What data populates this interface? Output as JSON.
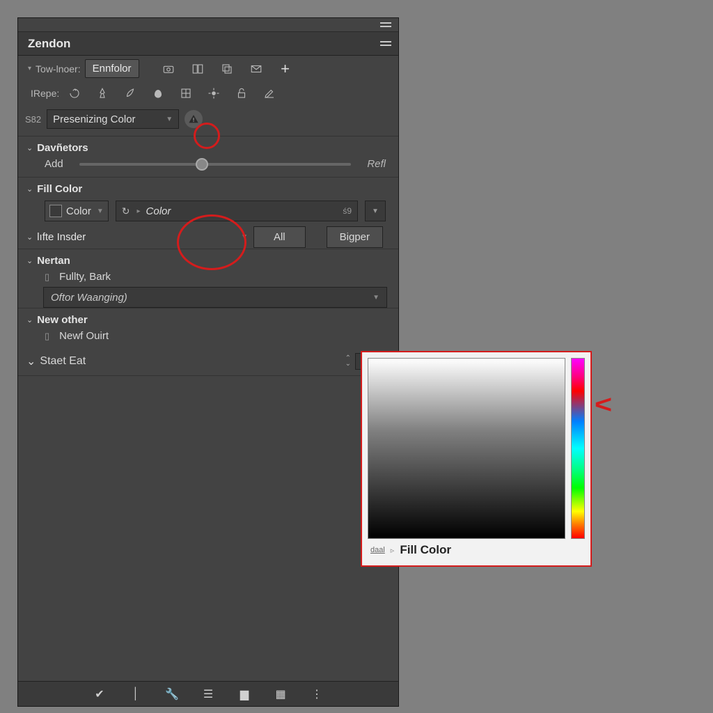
{
  "panel": {
    "title": "Zendon",
    "row1": {
      "label": "Tow-lnoer:",
      "button": "Ennfolor"
    },
    "row2": {
      "label": "IRepe:"
    },
    "preset": {
      "tag": "S82",
      "value": "Presenizing Color"
    },
    "sections": {
      "davnetors": {
        "label": "Davñetors",
        "slider_left": "Add",
        "slider_right": "Refl"
      },
      "fillcolor": {
        "label": "Fill Color",
        "swatch_label": "Color",
        "dd_label": "Color",
        "dd_tail": "ś9",
        "btn_all": "All",
        "btn_bigper": "Bigper"
      },
      "insider": {
        "label": "lıfte Insder"
      },
      "nertan": {
        "label": "Nertan",
        "sub": "Fullty, Bark",
        "dd": "Oftor Waanging)"
      },
      "newother": {
        "label": "New other",
        "sub": "Newf Ouirt"
      },
      "staet": {
        "label": "Staet Eat"
      }
    }
  },
  "picker": {
    "title": "Fill Color",
    "link": "daal"
  }
}
